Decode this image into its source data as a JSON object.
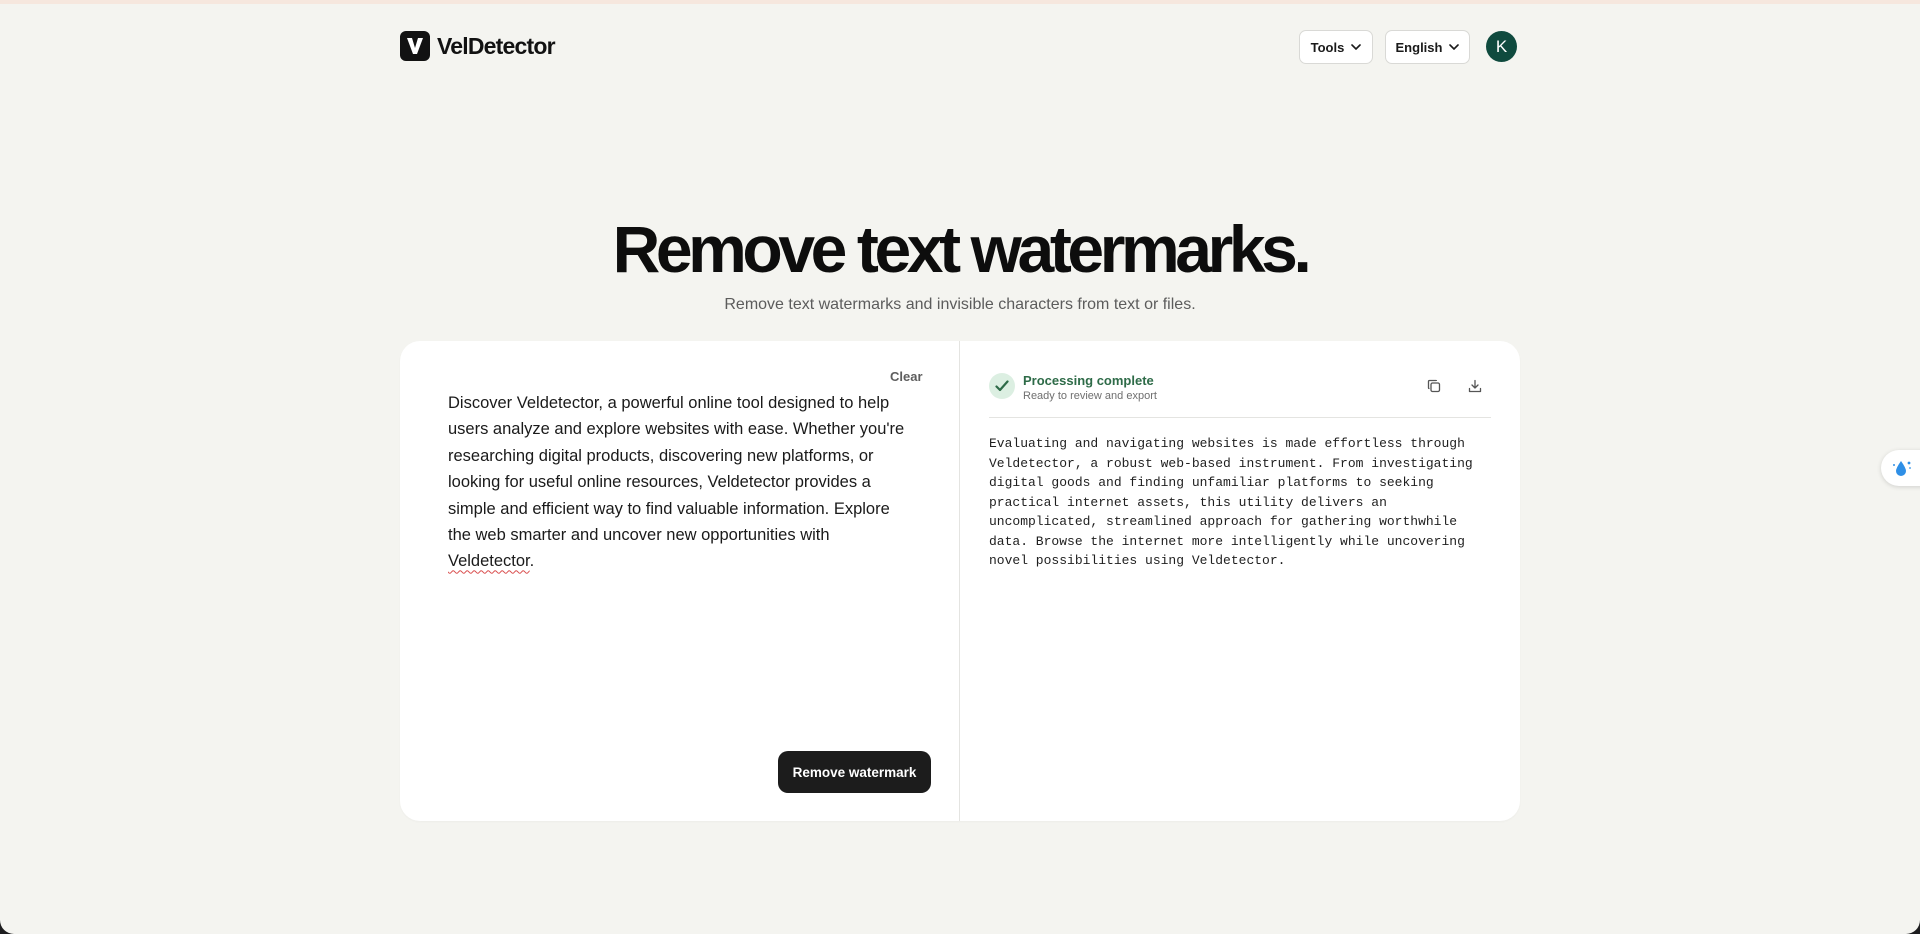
{
  "header": {
    "brand": "VelDetector",
    "tools_label": "Tools",
    "language_label": "English",
    "avatar_initial": "K"
  },
  "hero": {
    "title": "Remove text watermarks.",
    "subtitle": "Remove text watermarks and invisible characters from text or files."
  },
  "input_panel": {
    "clear_label": "Clear",
    "text_main": "Discover Veldetector, a powerful online tool designed to help\nusers analyze and explore websites with ease. Whether you're\nresearching digital products, discovering new platforms, or\nlooking for useful online resources, Veldetector provides a\nsimple and efficient way to find valuable information. Explore\nthe web smarter and uncover new opportunities with\n",
    "text_end_word": "Veldetector",
    "text_end_punct": ".",
    "submit_label": "Remove watermark"
  },
  "output_panel": {
    "status_title": "Processing complete",
    "status_subtitle": "Ready to review and export",
    "copy_icon": "copy-icon",
    "download_icon": "download-icon",
    "result_text": "Evaluating and navigating websites is made effortless through\nVeldetector, a robust web-based instrument. From investigating\ndigital goods and finding unfamiliar platforms to seeking\npractical internet assets, this utility delivers an\nuncomplicated, streamlined approach for gathering worthwhile\ndata. Browse the internet more intelligently while uncovering\nnovel possibilities using Veldetector."
  },
  "colors": {
    "page_bg": "#f4f4f0",
    "primary": "#1c1c1c",
    "avatar_bg": "#0f4a3e",
    "success": "#2e6b48"
  }
}
